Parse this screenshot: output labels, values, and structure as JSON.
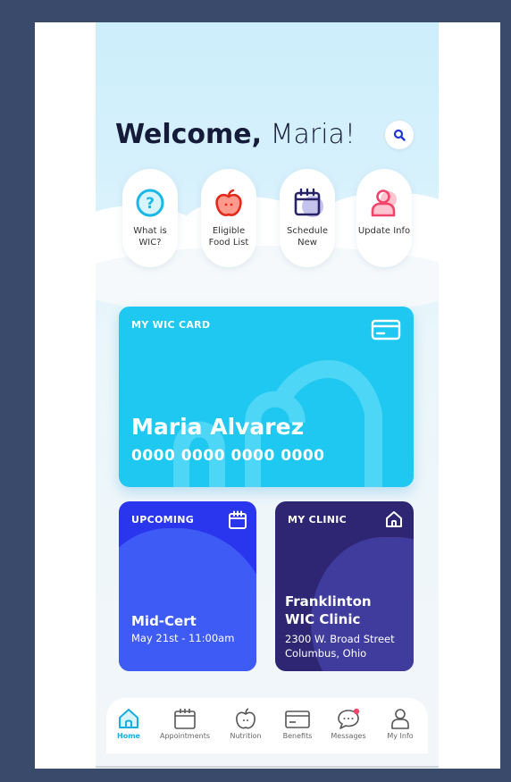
{
  "header": {
    "welcome_bold": "Welcome,",
    "welcome_name": "Maria!"
  },
  "quick_actions": [
    {
      "label": "What is WIC?",
      "icon": "question-icon"
    },
    {
      "label": "Eligible Food List",
      "icon": "apple-icon"
    },
    {
      "label": "Schedule New",
      "icon": "calendar-icon"
    },
    {
      "label": "Update Info",
      "icon": "person-icon"
    }
  ],
  "wic_card": {
    "label": "MY WIC CARD",
    "holder": "Maria Alvarez",
    "number": "0000 0000 0000 0000",
    "icon": "credit-card-icon"
  },
  "upcoming": {
    "label": "UPCOMING",
    "title": "Mid-Cert",
    "date": "May 21st - 11:00am",
    "icon": "calendar-icon"
  },
  "clinic": {
    "label": "MY CLINIC",
    "name_line1": "Franklinton",
    "name_line2": "WIC Clinic",
    "address_line1": "2300 W. Broad Street",
    "address_line2": "Columbus, Ohio",
    "icon": "home-icon"
  },
  "nav": [
    {
      "label": "Home",
      "icon": "home-icon",
      "active": true
    },
    {
      "label": "Appointments",
      "icon": "calendar-icon",
      "active": false
    },
    {
      "label": "Nutrition",
      "icon": "apple-icon",
      "active": false
    },
    {
      "label": "Benefits",
      "icon": "credit-card-icon",
      "active": false
    },
    {
      "label": "Messages",
      "icon": "chat-icon",
      "active": false
    },
    {
      "label": "My Info",
      "icon": "person-icon",
      "active": false
    }
  ],
  "colors": {
    "page_bg": "#3a4a6b",
    "sky": "#cdeefb",
    "wic_card": "#1ec8f1",
    "upcoming": "#2a36ee",
    "clinic": "#2e2673",
    "active_nav": "#18aee0",
    "title_text": "#161b3a"
  }
}
